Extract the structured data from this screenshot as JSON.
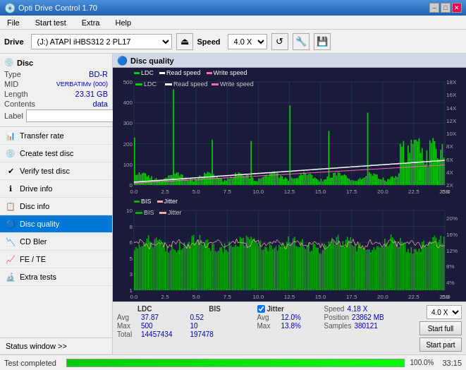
{
  "titlebar": {
    "title": "Opti Drive Control 1.70",
    "btn_min": "–",
    "btn_max": "□",
    "btn_close": "✕"
  },
  "menubar": {
    "items": [
      "File",
      "Start test",
      "Extra",
      "Help"
    ]
  },
  "toolbar": {
    "drive_label": "Drive",
    "drive_value": "(J:)  ATAPI iHBS312  2 PL17",
    "speed_label": "Speed",
    "speed_value": "4.0 X"
  },
  "disc": {
    "header": "Disc",
    "type_label": "Type",
    "type_value": "BD-R",
    "mid_label": "MID",
    "mid_value": "VERBATIMv (000)",
    "length_label": "Length",
    "length_value": "23.31 GB",
    "contents_label": "Contents",
    "contents_value": "data",
    "label_label": "Label"
  },
  "sidebar": {
    "items": [
      {
        "id": "transfer-rate",
        "label": "Transfer rate",
        "icon": "📊"
      },
      {
        "id": "create-test-disc",
        "label": "Create test disc",
        "icon": "💿"
      },
      {
        "id": "verify-test-disc",
        "label": "Verify test disc",
        "icon": "✔"
      },
      {
        "id": "drive-info",
        "label": "Drive info",
        "icon": "ℹ"
      },
      {
        "id": "disc-info",
        "label": "Disc info",
        "icon": "📋"
      },
      {
        "id": "disc-quality",
        "label": "Disc quality",
        "icon": "🔵",
        "active": true
      },
      {
        "id": "cd-bler",
        "label": "CD Bler",
        "icon": "📉"
      },
      {
        "id": "fe-te",
        "label": "FE / TE",
        "icon": "📈"
      },
      {
        "id": "extra-tests",
        "label": "Extra tests",
        "icon": "🔬"
      }
    ],
    "status_window": "Status window >>"
  },
  "chart": {
    "title": "Disc quality",
    "top_legend": {
      "ldc": "LDC",
      "read_speed": "Read speed",
      "write_speed": "Write speed"
    },
    "bottom_legend": {
      "bis": "BIS",
      "jitter": "Jitter"
    },
    "top_y_left": [
      "500",
      "400",
      "300",
      "200",
      "100"
    ],
    "top_y_right": [
      "18X",
      "16X",
      "14X",
      "12X",
      "10X",
      "8X",
      "6X",
      "4X",
      "2X"
    ],
    "bottom_y_left": [
      "10",
      "9",
      "8",
      "7",
      "6",
      "5",
      "4",
      "3",
      "2",
      "1"
    ],
    "bottom_y_right": [
      "20%",
      "16%",
      "12%",
      "8%",
      "4%"
    ],
    "x_labels": [
      "0.0",
      "2.5",
      "5.0",
      "7.5",
      "10.0",
      "12.5",
      "15.0",
      "17.5",
      "20.0",
      "22.5",
      "25.0 GB"
    ]
  },
  "stats": {
    "ldc_label": "LDC",
    "bis_label": "BIS",
    "avg_label": "Avg",
    "ldc_avg": "37.87",
    "bis_avg": "0.52",
    "max_label": "Max",
    "ldc_max": "500",
    "bis_max": "10",
    "total_label": "Total",
    "ldc_total": "14457434",
    "bis_total": "197478",
    "jitter_label": "Jitter",
    "jitter_avg": "12.0%",
    "jitter_max": "13.8%",
    "speed_label": "Speed",
    "speed_value": "4.18 X",
    "position_label": "Position",
    "position_value": "23862 MB",
    "samples_label": "Samples",
    "samples_value": "380121",
    "speed_select": "4.0 X",
    "start_full": "Start full",
    "start_part": "Start part"
  },
  "statusbar": {
    "text": "Test completed",
    "progress": "100.0%",
    "time": "33:15"
  },
  "colors": {
    "ldc_bar": "#00dd00",
    "bis_bar": "#00aa00",
    "read_speed_line": "#ffffff",
    "write_speed_line": "#ff69b4",
    "jitter_line": "#ffaaaa",
    "bg_chart": "#1a1a3a",
    "grid_line": "#334"
  }
}
